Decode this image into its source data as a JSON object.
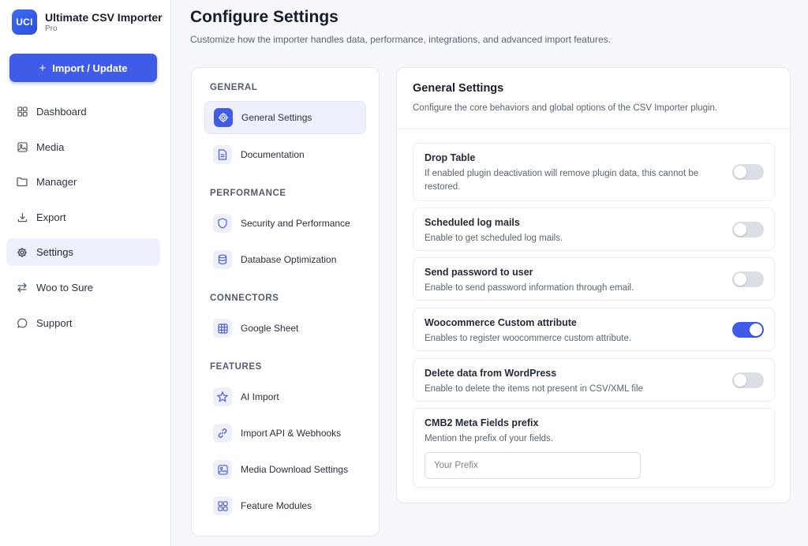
{
  "brand": {
    "logo_text": "UCI",
    "title": "Ultimate CSV Importer",
    "subtitle": "Pro"
  },
  "import_button": {
    "label": "Import / Update"
  },
  "nav": [
    {
      "label": "Dashboard",
      "icon": "dashboard-icon"
    },
    {
      "label": "Media",
      "icon": "image-icon"
    },
    {
      "label": "Manager",
      "icon": "folder-icon"
    },
    {
      "label": "Export",
      "icon": "download-icon"
    },
    {
      "label": "Settings",
      "icon": "gear-icon",
      "active": true
    },
    {
      "label": "Woo to Sure",
      "icon": "swap-icon"
    },
    {
      "label": "Support",
      "icon": "chat-icon"
    }
  ],
  "header": {
    "title": "Configure Settings",
    "description": "Customize how the importer handles data, performance, integrations, and advanced import features."
  },
  "menu": {
    "general": {
      "title": "GENERAL",
      "items": [
        {
          "label": "General Settings",
          "icon": "gear-icon",
          "active": true
        },
        {
          "label": "Documentation",
          "icon": "document-icon"
        }
      ]
    },
    "performance": {
      "title": "PERFORMANCE",
      "items": [
        {
          "label": "Security and Performance",
          "icon": "shield-icon"
        },
        {
          "label": "Database Optimization",
          "icon": "database-icon"
        }
      ]
    },
    "connectors": {
      "title": "CONNECTORS",
      "items": [
        {
          "label": "Google Sheet",
          "icon": "grid-icon"
        }
      ]
    },
    "features": {
      "title": "FEATURES",
      "items": [
        {
          "label": "AI Import",
          "icon": "star-icon"
        },
        {
          "label": "Import API & Webhooks",
          "icon": "link-icon"
        },
        {
          "label": "Media Download Settings",
          "icon": "image-icon"
        },
        {
          "label": "Feature Modules",
          "icon": "modules-icon"
        }
      ]
    }
  },
  "settings": {
    "title": "General Settings",
    "description": "Configure the core behaviors and global options of the CSV Importer plugin.",
    "rows": [
      {
        "label": "Drop Table",
        "description": "If enabled plugin deactivation will remove plugin data, this cannot be restored.",
        "enabled": false
      },
      {
        "label": "Scheduled log mails",
        "description": "Enable to get scheduled log mails.",
        "enabled": false
      },
      {
        "label": "Send password to user",
        "description": "Enable to send password information through email.",
        "enabled": false
      },
      {
        "label": "Woocommerce Custom attribute",
        "description": "Enables to register woocommerce custom attribute.",
        "enabled": true
      },
      {
        "label": "Delete data from WordPress",
        "description": "Enable to delete the items not present in CSV/XML file",
        "enabled": false
      }
    ],
    "prefix": {
      "label": "CMB2 Meta Fields prefix",
      "description": "Mention the prefix of your fields.",
      "value": "",
      "placeholder": "Your Prefix"
    }
  },
  "colors": {
    "accent": "#3f5be8",
    "toggle_off": "#dcdee6"
  }
}
